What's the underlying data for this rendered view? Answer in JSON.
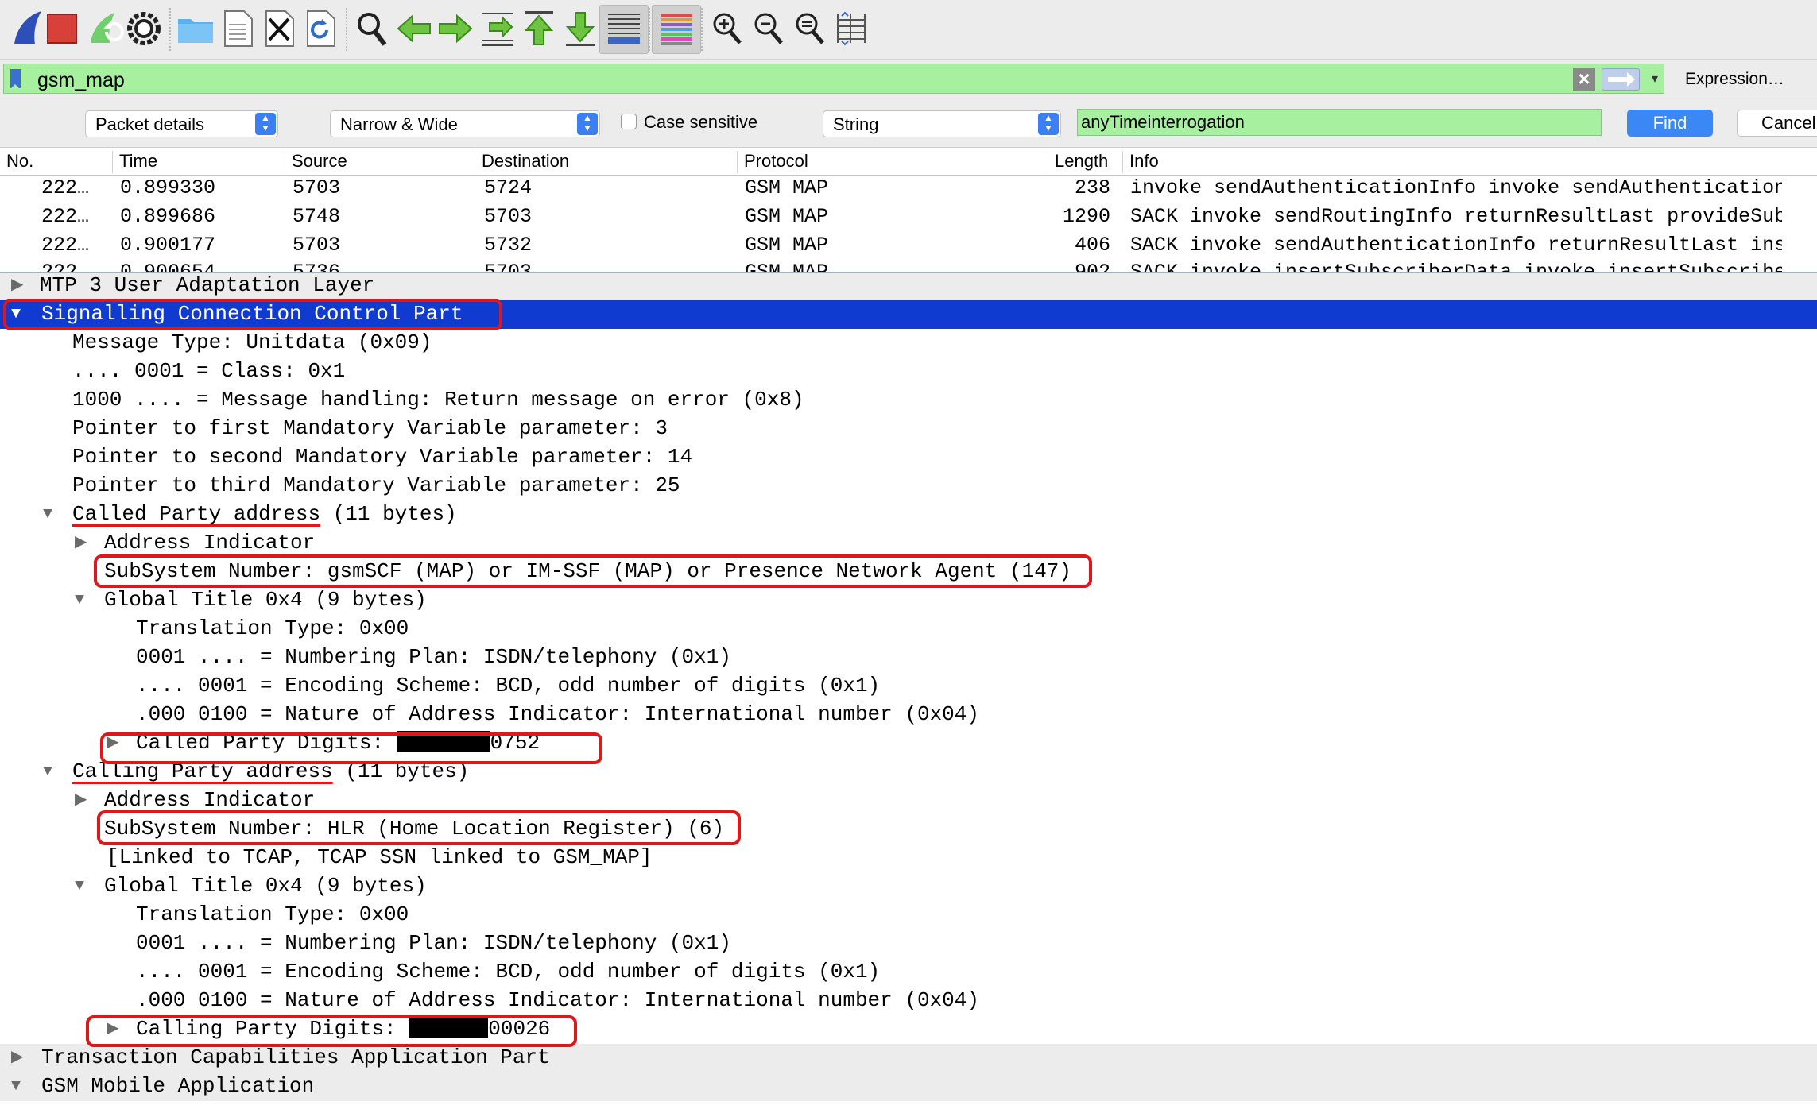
{
  "toolbar": {
    "icons": [
      "shark-fin-start-icon",
      "stop-capture-icon",
      "restart-capture-icon",
      "capture-options-icon",
      "open-folder-icon",
      "save-file-icon",
      "close-file-icon",
      "reload-file-icon",
      "find-packet-icon",
      "go-back-icon",
      "go-forward-icon",
      "go-to-packet-icon",
      "go-to-first-icon",
      "go-to-last-icon",
      "autoscroll-icon",
      "colorize-icon",
      "zoom-in-icon",
      "zoom-out-icon",
      "zoom-normal-icon",
      "resize-columns-icon"
    ]
  },
  "filter": {
    "value": "gsm_map",
    "expression_label": "Expression…",
    "clear_icon": "clear-icon",
    "apply_icon": "apply-arrow-icon"
  },
  "search": {
    "scope": "Packet details",
    "char_width": "Narrow & Wide",
    "case_sensitive_label": "Case sensitive",
    "case_sensitive": false,
    "type": "String",
    "value": "anyTimeinterrogation",
    "find_label": "Find",
    "cancel_label": "Cancel"
  },
  "packet_list": {
    "columns": [
      "No.",
      "Time",
      "Source",
      "Destination",
      "Protocol",
      "Length",
      "Info"
    ],
    "rows": [
      {
        "no": "222…",
        "time": "0.899330",
        "source": "5703",
        "destination": "5724",
        "protocol": "GSM MAP",
        "length": "238",
        "info": "invoke sendAuthenticationInfo invoke sendAuthenticationInfo"
      },
      {
        "no": "222…",
        "time": "0.899686",
        "source": "5748",
        "destination": "5703",
        "protocol": "GSM MAP",
        "length": "1290",
        "info": "SACK invoke sendRoutingInfo returnResultLast provideSubscriberInfo"
      },
      {
        "no": "222…",
        "time": "0.900177",
        "source": "5703",
        "destination": "5732",
        "protocol": "GSM MAP",
        "length": "406",
        "info": "SACK invoke sendAuthenticationInfo returnResultLast insertSubscriberData"
      },
      {
        "no": "222…",
        "time": "0.900654",
        "source": "5736",
        "destination": "5703",
        "protocol": "GSM MAP",
        "length": "902",
        "info": "SACK invoke insertSubscriberData invoke insertSubscriberData"
      }
    ]
  },
  "details": {
    "mtp3": "MTP 3 User Adaptation Layer",
    "sccp": "Signalling Connection Control Part",
    "message_type": "Message Type: Unitdata (0x09)",
    "class": ".... 0001 = Class: 0x1",
    "msg_handling": "1000 .... = Message handling: Return message on error (0x8)",
    "ptr1": "Pointer to first Mandatory Variable parameter: 3",
    "ptr2": "Pointer to second Mandatory Variable parameter: 14",
    "ptr3": "Pointer to third Mandatory Variable parameter: 25",
    "called_addr": "Called Party address",
    "called_addr_len": " (11 bytes)",
    "called_ai": "Address Indicator",
    "called_ssn": "SubSystem Number: gsmSCF (MAP) or IM-SSF (MAP) or Presence Network Agent (147)",
    "called_gt": "Global Title 0x4 (9 bytes)",
    "called_tt": "Translation Type: 0x00",
    "called_np": "0001 .... = Numbering Plan: ISDN/telephony (0x1)",
    "called_es": ".... 0001 = Encoding Scheme: BCD, odd number of digits (0x1)",
    "called_nai": ".000 0100 = Nature of Address Indicator: International number (0x04)",
    "called_digits_label": "Called Party Digits: ",
    "called_digits_tail": "0752",
    "calling_addr": "Calling Party address",
    "calling_addr_len": " (11 bytes)",
    "calling_ai": "Address Indicator",
    "calling_ssn": "SubSystem Number: HLR (Home Location Register) (6)",
    "calling_linked": "[Linked to TCAP, TCAP SSN linked to GSM_MAP]",
    "calling_gt": "Global Title 0x4 (9 bytes)",
    "calling_tt": "Translation Type: 0x00",
    "calling_np": "0001 .... = Numbering Plan: ISDN/telephony (0x1)",
    "calling_es": ".... 0001 = Encoding Scheme: BCD, odd number of digits (0x1)",
    "calling_nai": ".000 0100 = Nature of Address Indicator: International number (0x04)",
    "calling_digits_label": "Calling Party Digits: ",
    "calling_digits_tail": "00026",
    "tcap": "Transaction Capabilities Application Part",
    "gsm_map": "GSM Mobile Application"
  },
  "colors": {
    "filter_valid_bg": "#a6f0a0",
    "selected_row": "#0f3bd1",
    "annotation_red": "#e0161b",
    "find_button": "#3a87f5"
  }
}
